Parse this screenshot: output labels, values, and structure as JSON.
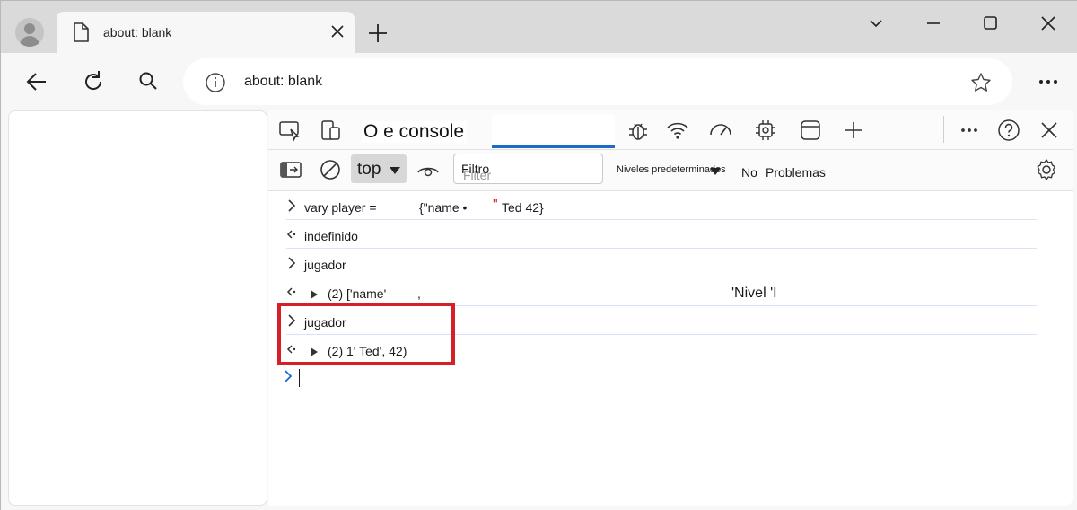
{
  "browser": {
    "tab_title": "about: blank",
    "address_url": "about: blank"
  },
  "devtools": {
    "tabs_text": "O e console",
    "context_label": "top",
    "filter_value": "Filtro",
    "filter_placeholder": "Filter",
    "levels_label": "Niveles predeterminados",
    "issues_count_label": "No",
    "issues_label": "Problemas"
  },
  "console": {
    "row1_input": "vary player =",
    "row1_value_a": "{\"name •",
    "row1_quote": "\"",
    "row1_value_b": "Ted 42}",
    "row2_output": "indefinido",
    "row3_input": "jugador",
    "row4_output": "(2) ['name'",
    "row4_comma": ",",
    "row4_extra": "'Nivel 'I",
    "row5_input": "jugador",
    "row6_output": "(2) 1' Ted', 42)"
  },
  "colors": {
    "accent_blue": "#1c6bc9",
    "highlight_red": "#d61f26"
  },
  "icons": [
    "profile-icon",
    "page-icon",
    "close-icon",
    "plus-icon",
    "chevron-down-icon",
    "minimize-icon",
    "maximize-icon",
    "back-icon",
    "refresh-icon",
    "search-icon",
    "info-icon",
    "star-icon",
    "more-icon",
    "inspect-icon",
    "device-icon",
    "bug-icon",
    "wifi-icon",
    "performance-icon",
    "cpu-icon",
    "application-icon",
    "help-icon",
    "sidebar-icon",
    "clear-icon",
    "eye-icon",
    "settings-icon"
  ]
}
